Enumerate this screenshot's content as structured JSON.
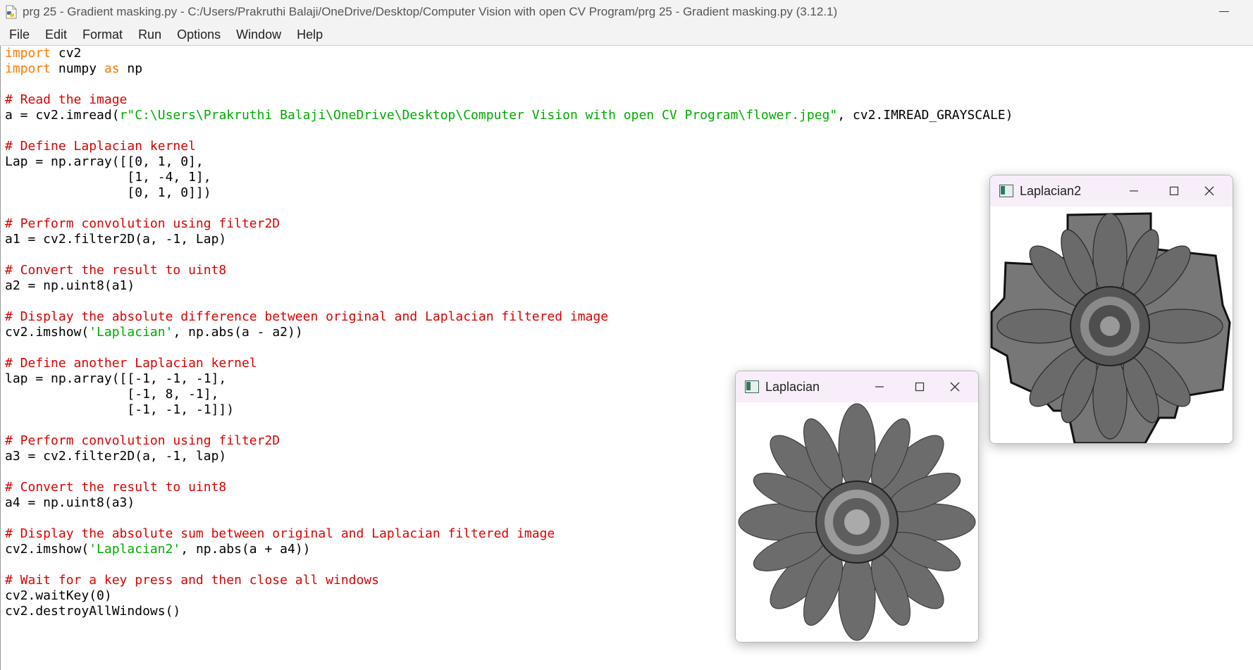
{
  "window": {
    "title": "prg 25 - Gradient masking.py - C:/Users/Prakruthi Balaji/OneDrive/Desktop/Computer Vision with open CV Program/prg 25 - Gradient masking.py (3.12.1)"
  },
  "menu": [
    "File",
    "Edit",
    "Format",
    "Run",
    "Options",
    "Window",
    "Help"
  ],
  "code_lines": [
    [
      {
        "t": "import",
        "c": "kw"
      },
      {
        "t": " cv2"
      }
    ],
    [
      {
        "t": "import",
        "c": "kw"
      },
      {
        "t": " numpy "
      },
      {
        "t": "as",
        "c": "kw"
      },
      {
        "t": " np"
      }
    ],
    [],
    [
      {
        "t": "# Read the image",
        "c": "cm"
      }
    ],
    [
      {
        "t": "a = cv2.imread("
      },
      {
        "t": "r\"C:\\Users\\Prakruthi Balaji\\OneDrive\\Desktop\\Computer Vision with open CV Program\\flower.jpeg\"",
        "c": "st"
      },
      {
        "t": ", cv2.IMREAD_GRAYSCALE)"
      }
    ],
    [],
    [
      {
        "t": "# Define Laplacian kernel",
        "c": "cm"
      }
    ],
    [
      {
        "t": "Lap = np.array([[0, 1, 0],"
      }
    ],
    [
      {
        "t": "                [1, -4, 1],"
      }
    ],
    [
      {
        "t": "                [0, 1, 0]])"
      }
    ],
    [],
    [
      {
        "t": "# Perform convolution using filter2D",
        "c": "cm"
      }
    ],
    [
      {
        "t": "a1 = cv2.filter2D(a, -1, Lap)"
      }
    ],
    [],
    [
      {
        "t": "# Convert the result to uint8",
        "c": "cm"
      }
    ],
    [
      {
        "t": "a2 = np.uint8(a1)"
      }
    ],
    [],
    [
      {
        "t": "# Display the absolute difference between original and Laplacian filtered image",
        "c": "cm"
      }
    ],
    [
      {
        "t": "cv2.imshow("
      },
      {
        "t": "'Laplacian'",
        "c": "st"
      },
      {
        "t": ", np.abs(a - a2))"
      }
    ],
    [],
    [
      {
        "t": "# Define another Laplacian kernel",
        "c": "cm"
      }
    ],
    [
      {
        "t": "lap = np.array([[-1, -1, -1],"
      }
    ],
    [
      {
        "t": "                [-1, 8, -1],"
      }
    ],
    [
      {
        "t": "                [-1, -1, -1]])"
      }
    ],
    [],
    [
      {
        "t": "# Perform convolution using filter2D",
        "c": "cm"
      }
    ],
    [
      {
        "t": "a3 = cv2.filter2D(a, -1, lap)"
      }
    ],
    [],
    [
      {
        "t": "# Convert the result to uint8",
        "c": "cm"
      }
    ],
    [
      {
        "t": "a4 = np.uint8(a3)"
      }
    ],
    [],
    [
      {
        "t": "# Display the absolute sum between original and Laplacian filtered image",
        "c": "cm"
      }
    ],
    [
      {
        "t": "cv2.imshow("
      },
      {
        "t": "'Laplacian2'",
        "c": "st"
      },
      {
        "t": ", np.abs(a + a4))"
      }
    ],
    [],
    [
      {
        "t": "# Wait for a key press and then close all windows",
        "c": "cm"
      }
    ],
    [
      {
        "t": "cv2.waitKey(0)"
      }
    ],
    [
      {
        "t": "cv2.destroyAllWindows()"
      }
    ]
  ],
  "windows": {
    "laplacian": {
      "title": "Laplacian"
    },
    "laplacian2": {
      "title": "Laplacian2"
    }
  },
  "colors": {
    "keyword": "#ff7700",
    "comment": "#dd0000",
    "string": "#00aa00",
    "window_title_bg": "#f7eefa"
  },
  "icons": [
    "python-file-icon",
    "minimize-icon",
    "maximize-icon",
    "close-icon",
    "opencv-window-icon"
  ]
}
